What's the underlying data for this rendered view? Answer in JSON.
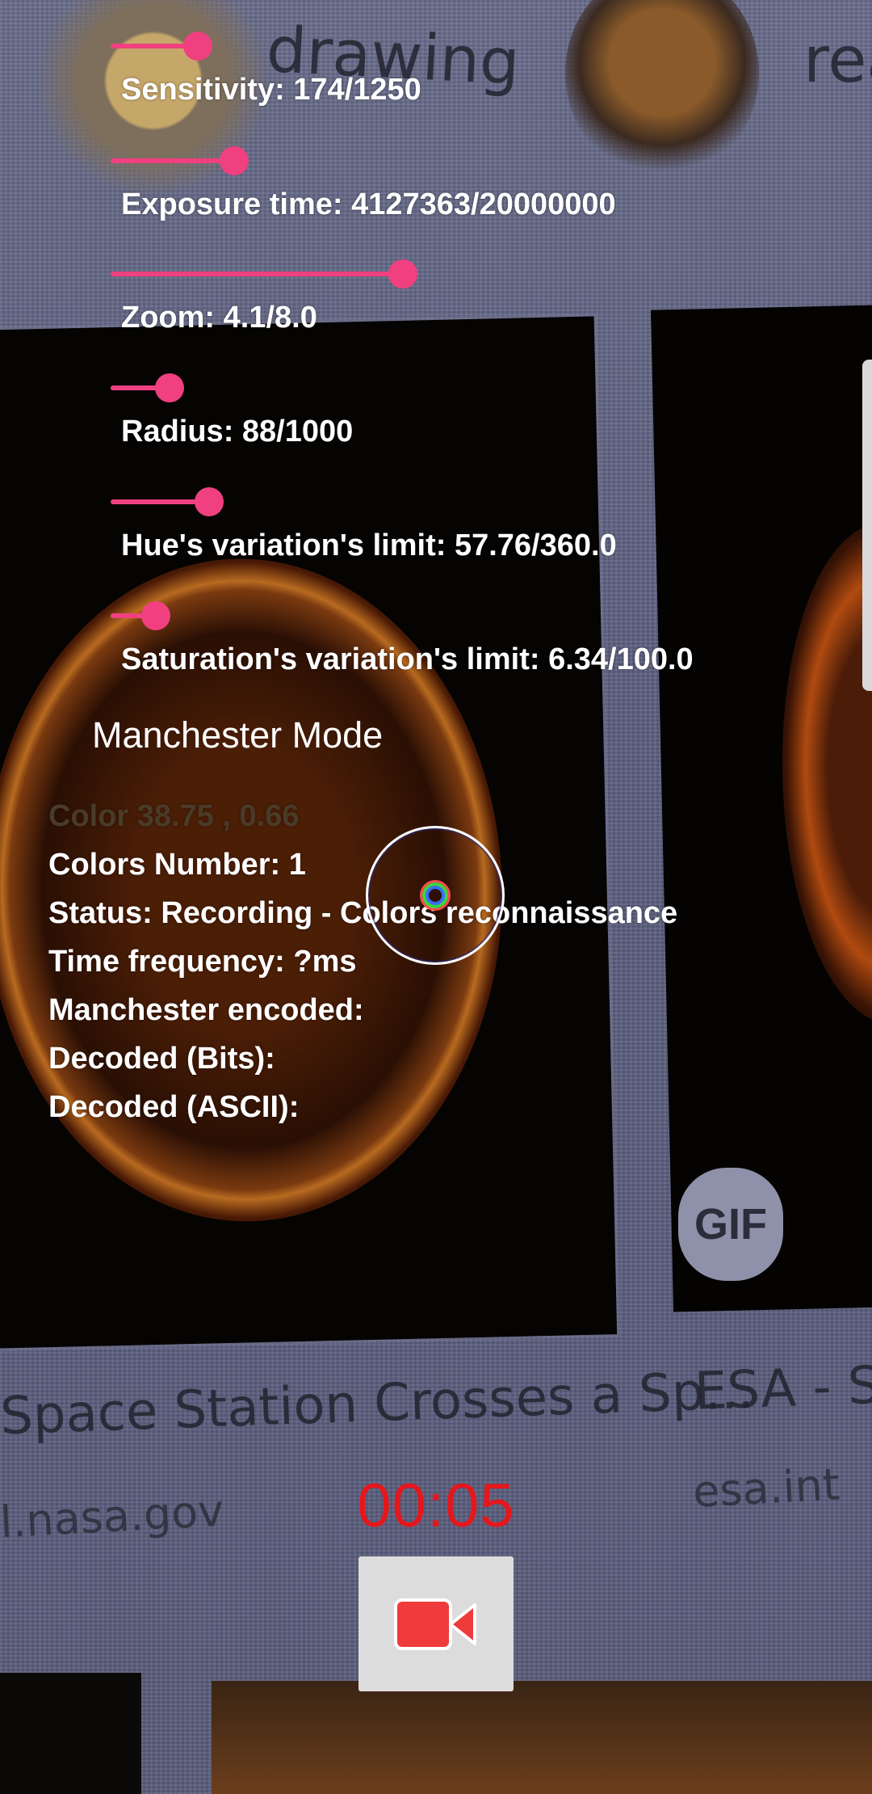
{
  "camera_preview": {
    "background_texts": {
      "drawing": "drawing",
      "real": "rea",
      "gif": "GIF",
      "caption_left": "Space Station Crosses a Sp...",
      "caption_right": "ESA - Sola",
      "source_left": "l.nasa.gov",
      "source_right": "esa.int"
    }
  },
  "sliders": [
    {
      "label": "Sensitivity: 174/1250",
      "value": 0.139,
      "color": "#f0407f"
    },
    {
      "label": "Exposure time: 4127363/20000000",
      "value": 0.206,
      "color": "#f0407f"
    },
    {
      "label": "Zoom: 4.1/8.0",
      "value": 0.513,
      "color": "#f0407f"
    },
    {
      "label": "Radius: 88/1000",
      "value": 0.088,
      "color": "#f0407f"
    },
    {
      "label": "Hue's variation's limit: 57.76/360.0",
      "value": 0.16,
      "color": "#f0407f"
    },
    {
      "label": "Saturation's variation's limit: 6.34/100.0",
      "value": 0.063,
      "color": "#f0407f"
    }
  ],
  "mode": {
    "label": "Manchester Mode"
  },
  "info": {
    "color": "Color 38.75 , 0.66",
    "colors_number": "Colors Number: 1",
    "status": "Status: Recording - Colors reconnaissance",
    "time_frequency": "Time frequency: ?ms",
    "manchester_encoded": "Manchester encoded:",
    "decoded_bits": "Decoded (Bits):",
    "decoded_ascii": "Decoded (ASCII):"
  },
  "recording": {
    "timer": "00:05",
    "button_icon": "video-camera-icon",
    "accent_color": "#e5171c"
  }
}
